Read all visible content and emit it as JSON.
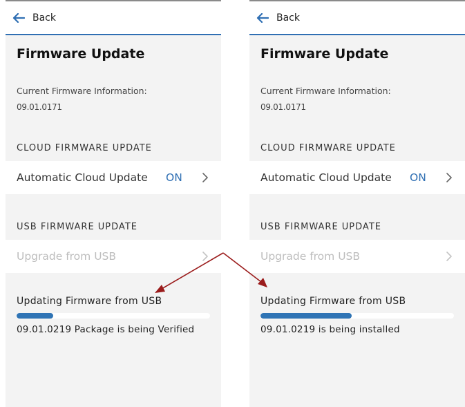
{
  "colors": {
    "accent": "#2f6fb3",
    "arrow": "#9b1c1c"
  },
  "panels": [
    {
      "back_label": "Back",
      "title": "Firmware Update",
      "current_fw_label": "Current Firmware Information:",
      "current_fw_value": "09.01.0171",
      "cloud_section": "CLOUD FIRMWARE UPDATE",
      "cloud_row_label": "Automatic Cloud Update",
      "cloud_row_state": "ON",
      "usb_section": "USB FIRMWARE UPDATE",
      "usb_row_label": "Upgrade from USB",
      "status_head": "Updating Firmware from USB",
      "progress": 0.19,
      "status_text": "09.01.0219 Package is being Verified"
    },
    {
      "back_label": "Back",
      "title": "Firmware Update",
      "current_fw_label": "Current Firmware Information:",
      "current_fw_value": "09.01.0171",
      "cloud_section": "CLOUD FIRMWARE UPDATE",
      "cloud_row_label": "Automatic Cloud Update",
      "cloud_row_state": "ON",
      "usb_section": "USB FIRMWARE UPDATE",
      "usb_row_label": "Upgrade from USB",
      "status_head": "Updating Firmware from USB",
      "progress": 0.47,
      "status_text": "09.01.0219 is being installed"
    }
  ]
}
